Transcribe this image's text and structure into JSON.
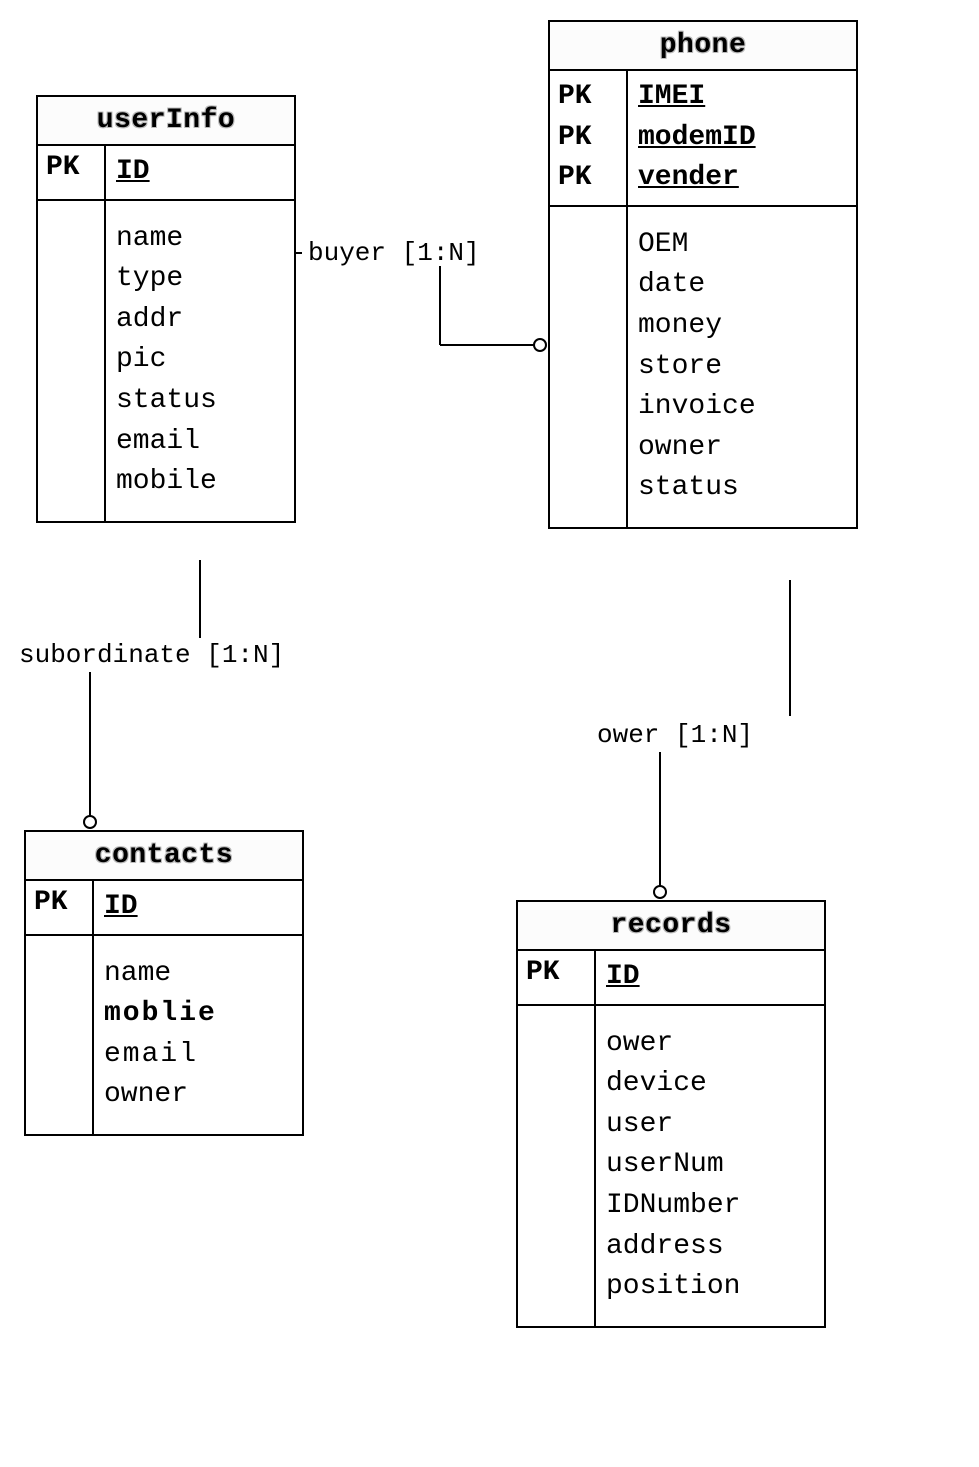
{
  "entities": {
    "userInfo": {
      "title": "userInfo",
      "pk_label": "PK",
      "pk_fields": [
        "ID"
      ],
      "fields": [
        "name",
        "type",
        "addr",
        "pic",
        "status",
        "email",
        "mobile"
      ]
    },
    "phone": {
      "title": "phone",
      "pk_label": "PK",
      "pk_label2": "PK",
      "pk_label3": "PK",
      "pk_fields": [
        "IMEI",
        "modemID",
        "vender"
      ],
      "fields": [
        "OEM",
        "date",
        "money",
        "store",
        "invoice",
        "owner",
        "status"
      ]
    },
    "contacts": {
      "title": "contacts",
      "pk_label": "PK",
      "pk_fields": [
        "ID"
      ],
      "fields": [
        "name",
        "moblie",
        "email",
        "owner"
      ]
    },
    "records": {
      "title": "records",
      "pk_label": "PK",
      "pk_fields": [
        "ID"
      ],
      "fields": [
        "ower",
        "device",
        "user",
        "userNum",
        "IDNumber",
        "address",
        "position"
      ]
    }
  },
  "relationships": {
    "buyer": "buyer [1:N]",
    "subordinate": "subordinate [1:N]",
    "ower": "ower [1:N]"
  },
  "chart_data": {
    "type": "er-diagram",
    "entities": [
      {
        "name": "userInfo",
        "primaryKeys": [
          "ID"
        ],
        "attributes": [
          "name",
          "type",
          "addr",
          "pic",
          "status",
          "email",
          "mobile"
        ]
      },
      {
        "name": "phone",
        "primaryKeys": [
          "IMEI",
          "modemID",
          "vender"
        ],
        "attributes": [
          "OEM",
          "date",
          "money",
          "store",
          "invoice",
          "owner",
          "status"
        ]
      },
      {
        "name": "contacts",
        "primaryKeys": [
          "ID"
        ],
        "attributes": [
          "name",
          "moblie",
          "email",
          "owner"
        ]
      },
      {
        "name": "records",
        "primaryKeys": [
          "ID"
        ],
        "attributes": [
          "ower",
          "device",
          "user",
          "userNum",
          "IDNumber",
          "address",
          "position"
        ]
      }
    ],
    "relationships": [
      {
        "from": "userInfo",
        "to": "phone",
        "label": "buyer",
        "cardinality": "1:N"
      },
      {
        "from": "userInfo",
        "to": "contacts",
        "label": "subordinate",
        "cardinality": "1:N"
      },
      {
        "from": "phone",
        "to": "records",
        "label": "ower",
        "cardinality": "1:N"
      }
    ]
  }
}
